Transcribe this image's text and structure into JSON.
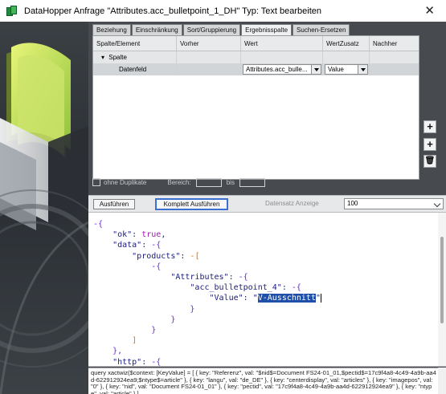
{
  "window": {
    "title": "DataHopper Anfrage \"Attributes.acc_bulletpoint_1_DH\" Typ: Text bearbeiten",
    "close_glyph": "✕"
  },
  "tabs": [
    {
      "label": "Beziehung",
      "active": false
    },
    {
      "label": "Einschränkung",
      "active": false
    },
    {
      "label": "Sort/Gruppierung",
      "active": false
    },
    {
      "label": "Ergebnisspalte",
      "active": true
    },
    {
      "label": "Suchen-Ersetzen",
      "active": false
    }
  ],
  "grid": {
    "columns": [
      "Spalte/Element",
      "Vorher",
      "Wert",
      "WertZusatz",
      "Nachher"
    ],
    "group_row": {
      "toggle": "▾",
      "label": "Spalte"
    },
    "data_row": {
      "element": "Datenfeld",
      "vorher": "",
      "wert": "Attributes.acc_bulle...",
      "wertzusatz": "Value",
      "nachher": ""
    }
  },
  "side_buttons": {
    "add": "+",
    "insert": "+",
    "delete": "🗑"
  },
  "options": {
    "ohne_duplikate_label": "ohne Duplikate",
    "bereich_label": "Bereich:",
    "bis_label": "bis"
  },
  "actions": {
    "run_label": "Ausführen",
    "run_all_label": "Komplett Ausführen",
    "datensatz_label": "Datensatz Anzeige",
    "datensatz_value": "100"
  },
  "json_lines": [
    [
      {
        "t": "-{",
        "c": "pu"
      }
    ],
    [
      {
        "t": "    \"ok\"",
        "c": "k"
      },
      {
        "t": ": ",
        "c": ""
      },
      {
        "t": "true",
        "c": "b"
      },
      {
        "t": ",",
        "c": ""
      }
    ],
    [
      {
        "t": "    \"data\"",
        "c": "k"
      },
      {
        "t": ": ",
        "c": ""
      },
      {
        "t": "-{",
        "c": "pu"
      }
    ],
    [
      {
        "t": "        \"products\"",
        "c": "k"
      },
      {
        "t": ": ",
        "c": ""
      },
      {
        "t": "-[",
        "c": "br"
      }
    ],
    [
      {
        "t": "            ",
        "c": ""
      },
      {
        "t": "-{",
        "c": "pu"
      }
    ],
    [
      {
        "t": "                \"Attributes\"",
        "c": "k"
      },
      {
        "t": ": ",
        "c": ""
      },
      {
        "t": "-{",
        "c": "pu"
      }
    ],
    [
      {
        "t": "                    \"acc_bulletpoint_4\"",
        "c": "k"
      },
      {
        "t": ": ",
        "c": ""
      },
      {
        "t": "-{",
        "c": "pu"
      }
    ],
    [
      {
        "t": "                        \"Value\"",
        "c": "k"
      },
      {
        "t": ": ",
        "c": ""
      },
      {
        "t": "\"",
        "c": "s"
      },
      {
        "t": "V-Ausschnitt",
        "c": "hl"
      },
      {
        "t": "\"",
        "c": "s"
      }
    ],
    [
      {
        "t": "                    }",
        "c": "pu"
      }
    ],
    [
      {
        "t": "                }",
        "c": "pu"
      }
    ],
    [
      {
        "t": "            }",
        "c": "pu"
      }
    ],
    [
      {
        "t": "        ]",
        "c": "br"
      }
    ],
    [
      {
        "t": "    },",
        "c": "pu"
      }
    ],
    [
      {
        "t": "    \"http\"",
        "c": "k"
      },
      {
        "t": ": ",
        "c": ""
      },
      {
        "t": "-{",
        "c": "pu"
      }
    ]
  ],
  "query_text": "query xactwiz($context: [KeyValue] = [ { key: \"Referenz\", val: \"$nid$=Document FS24-01_01,$pectid$=17c9f4a8-4c49-4a9b-aa4d-622912924ea9;$ntype$=article\" }, { key: \"langu\", val: \"de_DE\" }, { key: \"centerdisplay\", val: \"articles\" }, { key: \"imagepos\", val: \"0\" }, { key: \"nid\", val: \"Document FS24-01_01\" }, { key: \"pectid\", val: \"17c9f4a8-4c49-4a9b-aa4d-622912924ea9\" }, { key: \"ntype\", val: \"article\" } ]"
}
